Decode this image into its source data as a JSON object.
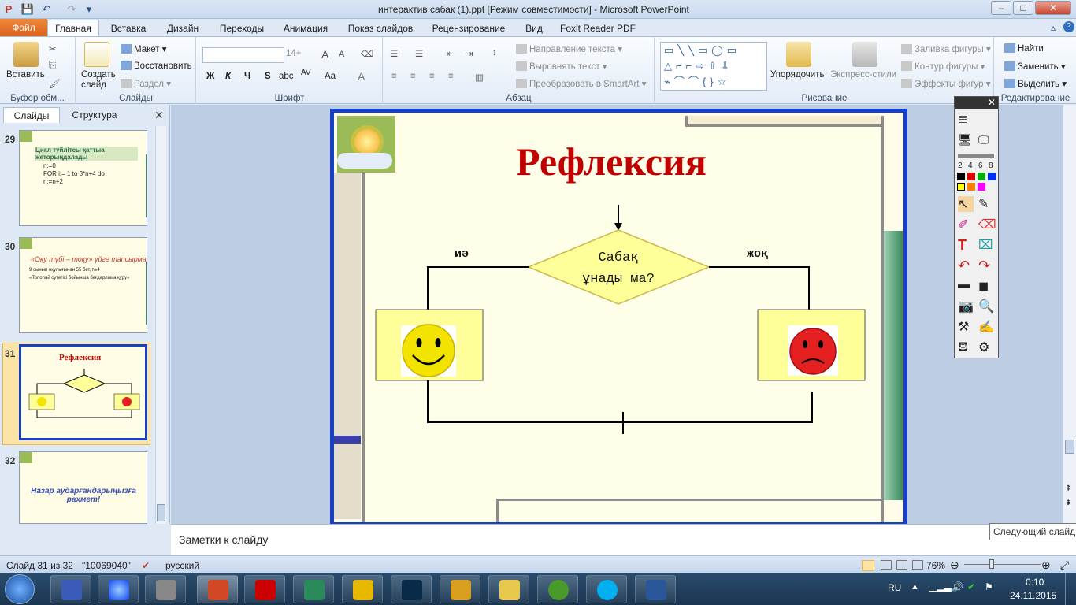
{
  "window": {
    "title": "интерактив сабак (1).ppt [Режим совместимости]  -  Microsoft PowerPoint",
    "close": "✕",
    "min": "–",
    "max": "□"
  },
  "tabs": [
    "Файл",
    "Главная",
    "Вставка",
    "Дизайн",
    "Переходы",
    "Анимация",
    "Показ слайдов",
    "Рецензирование",
    "Вид",
    "Foxit Reader PDF"
  ],
  "ribbon": {
    "clipboard": {
      "label": "Буфер обм...",
      "paste": "Вставить"
    },
    "slides": {
      "label": "Слайды",
      "new": "Создать\nслайд",
      "layout": "Макет",
      "reset": "Восстановить",
      "section": "Раздел"
    },
    "font": {
      "label": "Шрифт",
      "size": "14+",
      "bold": "Ж",
      "italic": "К",
      "underline": "Ч",
      "strike": "abc",
      "shadow": "S",
      "spacing": "AV",
      "case": "Aa",
      "color": "A"
    },
    "paragraph": {
      "label": "Абзац",
      "direction": "Направление текста",
      "align": "Выровнять текст",
      "smartart": "Преобразовать в SmartArt"
    },
    "drawing": {
      "label": "Рисование",
      "arrange": "Упорядочить",
      "styles": "Экспресс-стили",
      "fill": "Заливка фигуры",
      "outline": "Контур фигуры",
      "effects": "Эффекты фигур"
    },
    "editing": {
      "label": "Редактирование",
      "find": "Найти",
      "replace": "Заменить",
      "select": "Выделить"
    }
  },
  "leftpanel": {
    "tab_slides": "Слайды",
    "tab_outline": "Структура",
    "thumbs": [
      {
        "num": "29",
        "title": "Цикл  түйлітсы қаттыа жеторыңдалады",
        "lines": [
          "n:=0",
          "FOR i:= 1 to 3*n+4 do",
          "n:=n+2"
        ]
      },
      {
        "num": "30",
        "title": "«Оқу түбі – тоқу» үйге тапсырма",
        "lines": [
          "9 сынып оқулығынан 55 бет, №4",
          "«Толопай сүтегісі бойынша бағдарлама құру»"
        ]
      },
      {
        "num": "31",
        "title": "Рефлексия",
        "lines": []
      },
      {
        "num": "32",
        "title": "Назар аударғандарыңызға рахмет!",
        "lines": []
      }
    ]
  },
  "slide": {
    "title": "Рефлексия",
    "question_line1": "Сабақ",
    "question_line2": "ұнады ма?",
    "yes": "иә",
    "no": "жоқ",
    "colors": {
      "title": "#c00000",
      "diamond": "#ffff99",
      "box": "#ffff99"
    }
  },
  "notes": {
    "placeholder": "Заметки к слайду"
  },
  "tooltip": "Следующий слайд",
  "status": {
    "slide": "Слайд 31 из 32",
    "theme": "\"10069040\"",
    "lang": "русский",
    "zoom": "76%"
  },
  "tray": {
    "lang": "RU",
    "time": "0:10",
    "date": "24.11.2015"
  },
  "ink": {
    "sizes": [
      "2",
      "4",
      "6",
      "8"
    ]
  }
}
